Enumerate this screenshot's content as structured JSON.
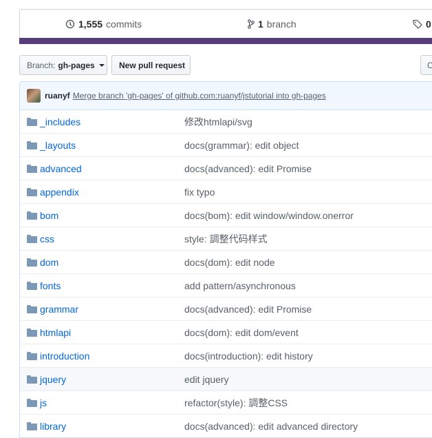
{
  "summary": {
    "commits_count": "1,555",
    "commits_label": "commits",
    "branch_count": "1",
    "branch_label": "branch",
    "release_count": "0"
  },
  "toolbar": {
    "branch_prefix": "Branch:",
    "branch_name": "gh-pages",
    "new_pr_label": "New pull request",
    "clone_label": "C"
  },
  "latest_commit": {
    "author": "ruanyf",
    "message": "Merge branch 'gh-pages' of github.com:ruanyf/jstutorial into gh-pages"
  },
  "files": [
    {
      "name": "_includes",
      "message": "修改htmlapi/svg"
    },
    {
      "name": "_layouts",
      "message": "docs(grammar): edit object"
    },
    {
      "name": "advanced",
      "message": "docs(advanced): edit Promise"
    },
    {
      "name": "appendix",
      "message": "fix typo"
    },
    {
      "name": "bom",
      "message": "docs(bom): edit window/window.onerror"
    },
    {
      "name": "css",
      "message": "style: 調整代码样式"
    },
    {
      "name": "dom",
      "message": "docs(dom): edit node"
    },
    {
      "name": "fonts",
      "message": "add pattern/asynchronous"
    },
    {
      "name": "grammar",
      "message": "docs(advanced): edit Promise"
    },
    {
      "name": "htmlapi",
      "message": "docs(dom): edit dom/event"
    },
    {
      "name": "introduction",
      "message": "docs(introduction): edit history"
    },
    {
      "name": "jquery",
      "message": "edit jquery"
    },
    {
      "name": "js",
      "message": "refactor(style): 調整CSS"
    },
    {
      "name": "library",
      "message": "docs(advanced): edit advanced directory"
    }
  ],
  "colors": {
    "language_bar": "#563d7c",
    "link": "#0366d6",
    "commit_bg": "#f1f8ff"
  }
}
